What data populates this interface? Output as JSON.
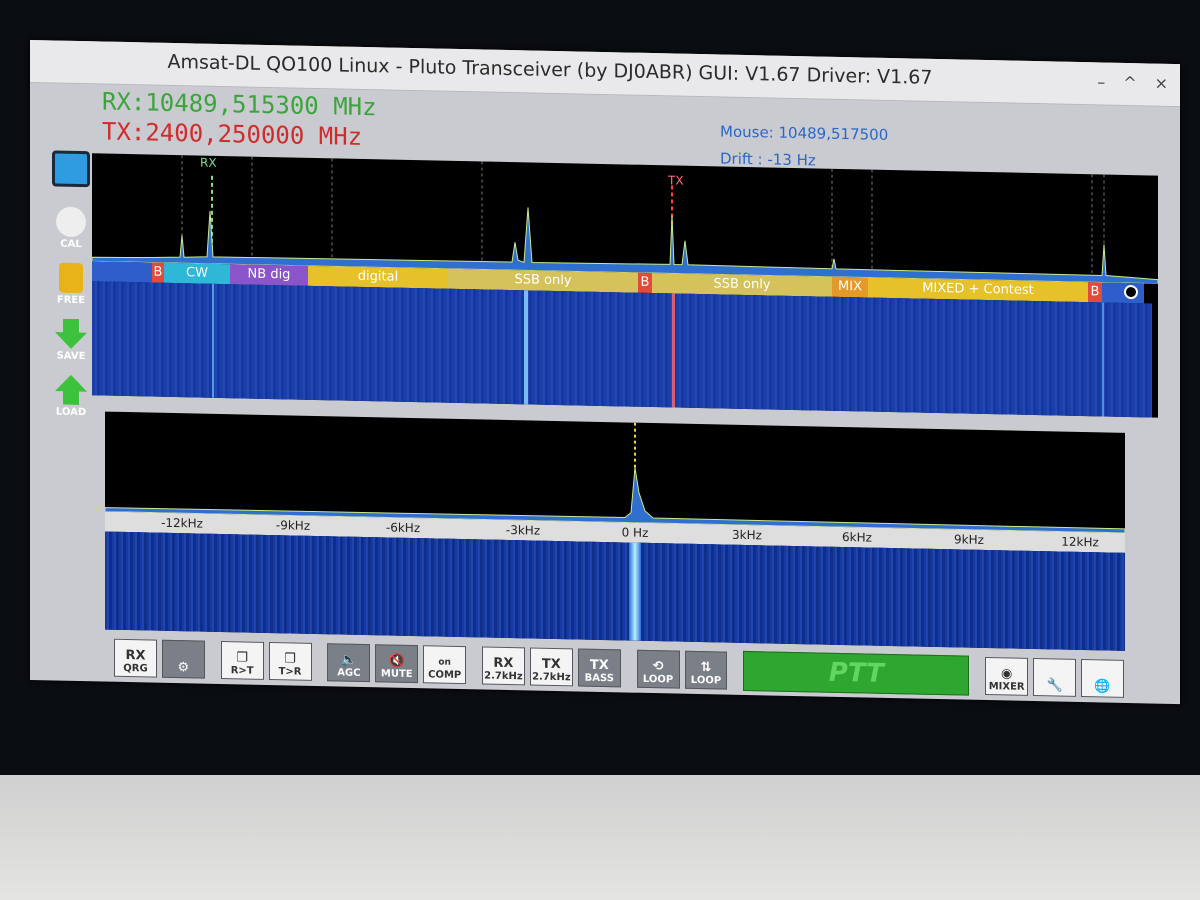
{
  "window": {
    "title": "Amsat-DL QO100 Linux - Pluto Transceiver (by DJ0ABR) GUI: V1.67 Driver: V1.67",
    "controls": [
      "–",
      "^",
      "×"
    ]
  },
  "frequencies": {
    "rx": "RX:10489,515300 MHz",
    "tx": "TX:2400,250000 MHz"
  },
  "info": {
    "mouse": "Mouse:  10489,517500",
    "drift": "Drift : -13 Hz"
  },
  "sidebar": [
    {
      "label": "",
      "icon": "monitor-icon"
    },
    {
      "label": "CAL",
      "icon": "gauge-icon"
    },
    {
      "label": "FREE",
      "icon": "lock-icon"
    },
    {
      "label": "SAVE",
      "icon": "save-arrow-icon"
    },
    {
      "label": "LOAD",
      "icon": "load-arrow-icon"
    }
  ],
  "wide_spectrum": {
    "markers": {
      "rx": "RX",
      "tx": "TX"
    },
    "bands": [
      {
        "label": "B",
        "color": "#e24a3b"
      },
      {
        "label": "CW",
        "color": "#2fb7d8"
      },
      {
        "label": "NB dig",
        "color": "#8a55c9"
      },
      {
        "label": "digital",
        "color": "#e6c12a"
      },
      {
        "label": "SSB only",
        "color": "#d6c25a"
      },
      {
        "label": "B",
        "color": "#e24a3b"
      },
      {
        "label": "SSB only",
        "color": "#d6c25a"
      },
      {
        "label": "MIX",
        "color": "#e39a2a"
      },
      {
        "label": "MIXED + Contest",
        "color": "#e6c12a"
      },
      {
        "label": "B",
        "color": "#e24a3b"
      }
    ]
  },
  "narrow_spectrum": {
    "axis_labels": [
      "-12kHz",
      "-9kHz",
      "-6kHz",
      "-3kHz",
      "0 Hz",
      "3kHz",
      "6kHz",
      "9kHz",
      "12kHz"
    ]
  },
  "toolbar": {
    "rx_qrg": {
      "top": "RX",
      "bottom": "QRG"
    },
    "setup": "",
    "r_to_t": "R>T",
    "t_to_r": "T>R",
    "agc": "AGC",
    "mute": "MUTE",
    "comp": {
      "top": "on",
      "bottom": "COMP"
    },
    "rx_filter": {
      "top": "RX",
      "bottom": "2.7kHz"
    },
    "tx_filter": {
      "top": "TX",
      "bottom": "2.7kHz"
    },
    "bass": {
      "top": "TX",
      "bottom": "BASS"
    },
    "loop1": "LOOP",
    "loop2": "LOOP",
    "ptt": "PTT",
    "mixer": "MIXER"
  },
  "colors": {
    "rx_text": "#3ba43b",
    "tx_text": "#d12b2b",
    "info_text": "#2a67c8",
    "ptt_bg": "#2fa62f"
  }
}
